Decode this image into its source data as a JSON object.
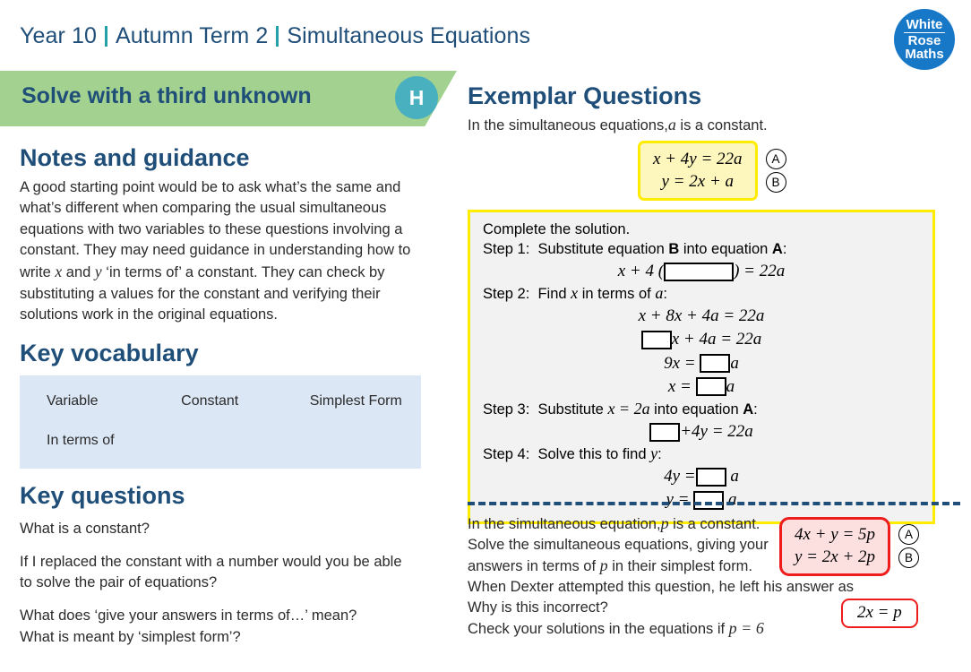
{
  "header": {
    "year": "Year 10",
    "term": "Autumn Term 2",
    "topic": "Simultaneous Equations",
    "logo": {
      "line1": "White",
      "line2": "Rose",
      "line3": "Maths"
    },
    "colors": {
      "navy": "#1f4e79",
      "teal": "#22a0a8",
      "logo_blue": "#1878c8"
    }
  },
  "banner": {
    "title": "Solve with a third unknown",
    "badge": "H",
    "green": "#a3d18f",
    "badge_color": "#49b0c0"
  },
  "notes": {
    "heading": "Notes and guidance",
    "line1": "A good starting point would be to ask what’s the same and",
    "line2": "what’s different when comparing the usual simultaneous",
    "line3": "equations with two variables to these questions involving a",
    "line4": "constant. They may need guidance in understanding how to",
    "line5_a": "write ",
    "line5_x": "x",
    "line5_b": " and ",
    "line5_y": "y",
    "line5_c": " ‘in terms of’ a constant. They can check by",
    "line6": "substituting a values for the constant and verifying their",
    "line7": "solutions work in the original equations."
  },
  "vocabulary": {
    "heading": "Key vocabulary",
    "row1": [
      "Variable",
      "Constant",
      "Simplest Form"
    ],
    "row2": [
      "In terms of",
      "",
      ""
    ],
    "box_color": "#dce7f5"
  },
  "key_questions": {
    "heading": "Key questions",
    "q1": "What is a constant?",
    "q2_line1": "If I replaced the constant with a number would you be able",
    "q2_line2": "to solve the pair of equations?",
    "q3": "What does ‘give your answers in terms of…’ mean?",
    "q4": "What is meant by ‘simplest form’?"
  },
  "exemplar": {
    "heading": "Exemplar Questions",
    "intro_a": "In the simultaneous equations,",
    "intro_var": "a",
    "intro_b": " is a constant.",
    "equations": {
      "eq_a": "x + 4y = 22a",
      "eq_b": "y = 2x + a",
      "label_a": "A",
      "label_b": "B",
      "fill": "#fdf6bd",
      "border": "#ffec00"
    },
    "solution": {
      "title": "Complete the solution.",
      "step1_label": "Step 1:",
      "step1_pre": "Substitute equation ",
      "step1_eqb": "B",
      "step1_mid": " into equation ",
      "step1_eqa": "A",
      "step1_end": ":",
      "step1_eq_left": "x + 4 (",
      "step1_eq_right": ") = 22a",
      "step2_label": "Step 2:",
      "step2_pre": "Find ",
      "step2_x": "x",
      "step2_mid": " in terms of ",
      "step2_a": "a",
      "step2_end": ":",
      "step2_eq1": "x + 8x + 4a = 22a",
      "step2_eq2_right": "x + 4a = 22a",
      "step2_eq3_left": "9x =",
      "step2_eq3_right": "a",
      "step2_eq4_left": "x =",
      "step2_eq4_right": "a",
      "step3_label": "Step 3:",
      "step3_pre": "Substitute ",
      "step3_eq": "x = 2a",
      "step3_mid": " into equation ",
      "step3_eqa": "A",
      "step3_end": ":",
      "step3_eq1_right": "+4y = 22a",
      "step4_label": "Step 4:",
      "step4_pre": "Solve this to find ",
      "step4_y": "y",
      "step4_end": ":",
      "step4_eq1_left": "4y =",
      "step4_eq1_right": "a",
      "step4_eq2_left": "y =",
      "step4_eq2_right": "a",
      "box_fill": "#f2f2f2",
      "box_border": "#ffec00"
    }
  },
  "bottom_question": {
    "line1_a": "In the simultaneous equation,",
    "line1_var": "p",
    "line1_b": " is a constant.",
    "line2": "Solve the simultaneous equations, giving your",
    "line3_a": "answers in terms of ",
    "line3_var": "p",
    "line3_b": " in their simplest form.",
    "line4": "When Dexter attempted this question, he left his answer as",
    "line5": "Why is this incorrect?",
    "line6_a": "Check your solutions in the equations if ",
    "line6_eq": "p = 6",
    "equations": {
      "eq_a": "4x + y = 5p",
      "eq_b": "y = 2x + 2p",
      "label_a": "A",
      "label_b": "B",
      "fill": "#fce0e0",
      "border": "#ee1c1c"
    },
    "dexter_answer": "2x = p"
  }
}
